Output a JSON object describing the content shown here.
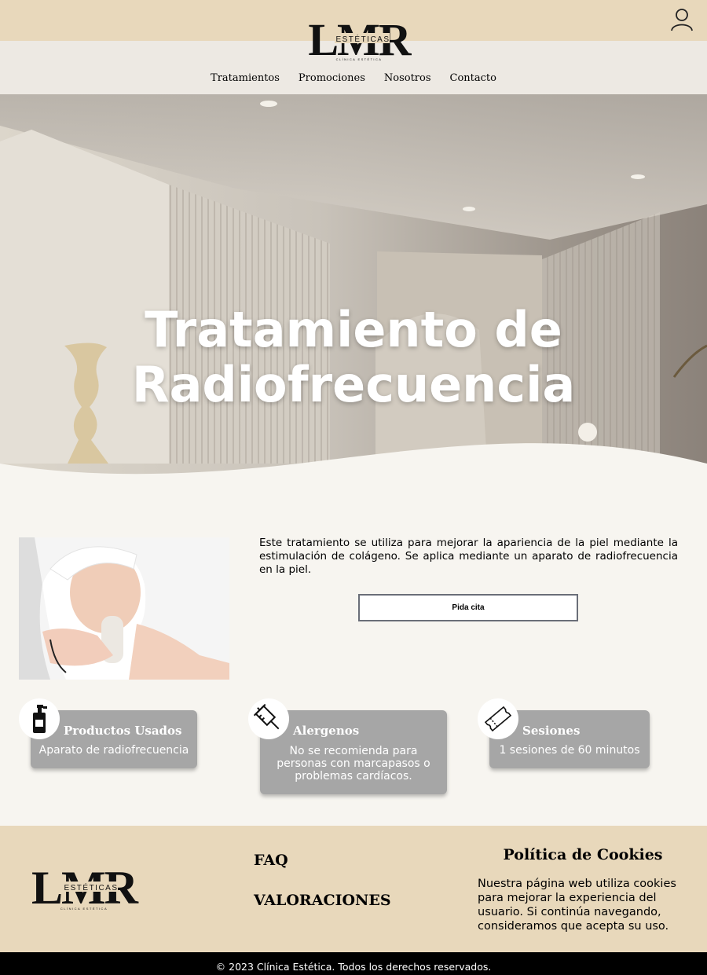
{
  "header": {
    "logo_text": "LMR",
    "logo_sub": "ESTÉTICAS",
    "logo_tagline": "CLÍNICA ESTÉTICA",
    "nav": [
      "Tratamientos",
      "Promociones",
      "Nosotros",
      "Contacto"
    ],
    "user_icon": "user-icon"
  },
  "hero": {
    "title_line1": "Tratamiento de",
    "title_line2": "Radiofrecuencia"
  },
  "main": {
    "description": "Este tratamiento se utiliza para mejorar la apariencia de la piel mediante la estimulación de colágeno. Se aplica mediante un aparato de radiofrecuencia en la piel.",
    "cta_label": "Pida cita",
    "cards": [
      {
        "icon": "pump-bottle-icon",
        "title": "Productos Usados",
        "text": "Aparato de radiofrecuencia"
      },
      {
        "icon": "syringe-icon",
        "title": "Alergenos",
        "text": "No se recomienda para personas con marcapasos o problemas cardíacos."
      },
      {
        "icon": "ticket-icon",
        "title": "Sesiones",
        "text": "1 sesiones de 60 minutos"
      }
    ]
  },
  "footer": {
    "links": [
      "FAQ",
      "VALORACIONES"
    ],
    "cookies_title": "Política de Cookies",
    "cookies_text": "Nuestra página web utiliza cookies para mejorar la experiencia del usuario. Si continúa navegando, consideramos que acepta su uso.",
    "copyright": "© 2023 Clínica Estética. Todos los derechos reservados."
  },
  "colors": {
    "beige": "#e8d8bb",
    "nav_bg": "#ede9e3",
    "page_bg": "#f7f5f0",
    "card_gray": "#a6a6a6",
    "bottom_bar": "#000000"
  }
}
